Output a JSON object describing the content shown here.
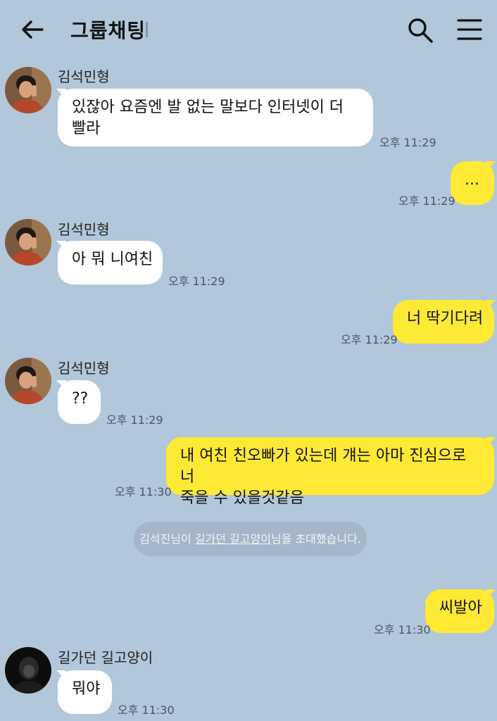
{
  "header": {
    "title": "그룹채팅"
  },
  "messages": [
    {
      "sender": "김석민형",
      "text": "있잖아 요즘엔 발 없는 말보다 인터넷이 더\n빨라",
      "time": "오후 11:29"
    },
    {
      "text": "...",
      "time": "오후 11:29"
    },
    {
      "sender": "김석민형",
      "text": "아 뭐 니여친",
      "time": "오후 11:29"
    },
    {
      "text": "너 딱기다려",
      "time": "오후 11:29"
    },
    {
      "sender": "김석민형",
      "text": "??",
      "time": "오후 11:29"
    },
    {
      "text": "내 여친 친오빠가 있는데 걔는 아마 진심으로 너\n죽을 수 있을것같음",
      "time": "오후 11:30"
    },
    {
      "text": "씨발아",
      "time": "오후 11:30"
    },
    {
      "sender": "길가던 길고양이",
      "text": "뭐야",
      "time": "오후 11:30"
    }
  ],
  "system_notice": {
    "inviter": "김석진님이 ",
    "invitee": "길가던 길고양이",
    "suffix": "님을 초대했습니다."
  },
  "colors": {
    "background": "#b2c7da",
    "my_bubble": "#fee935",
    "their_bubble": "#ffffff"
  }
}
